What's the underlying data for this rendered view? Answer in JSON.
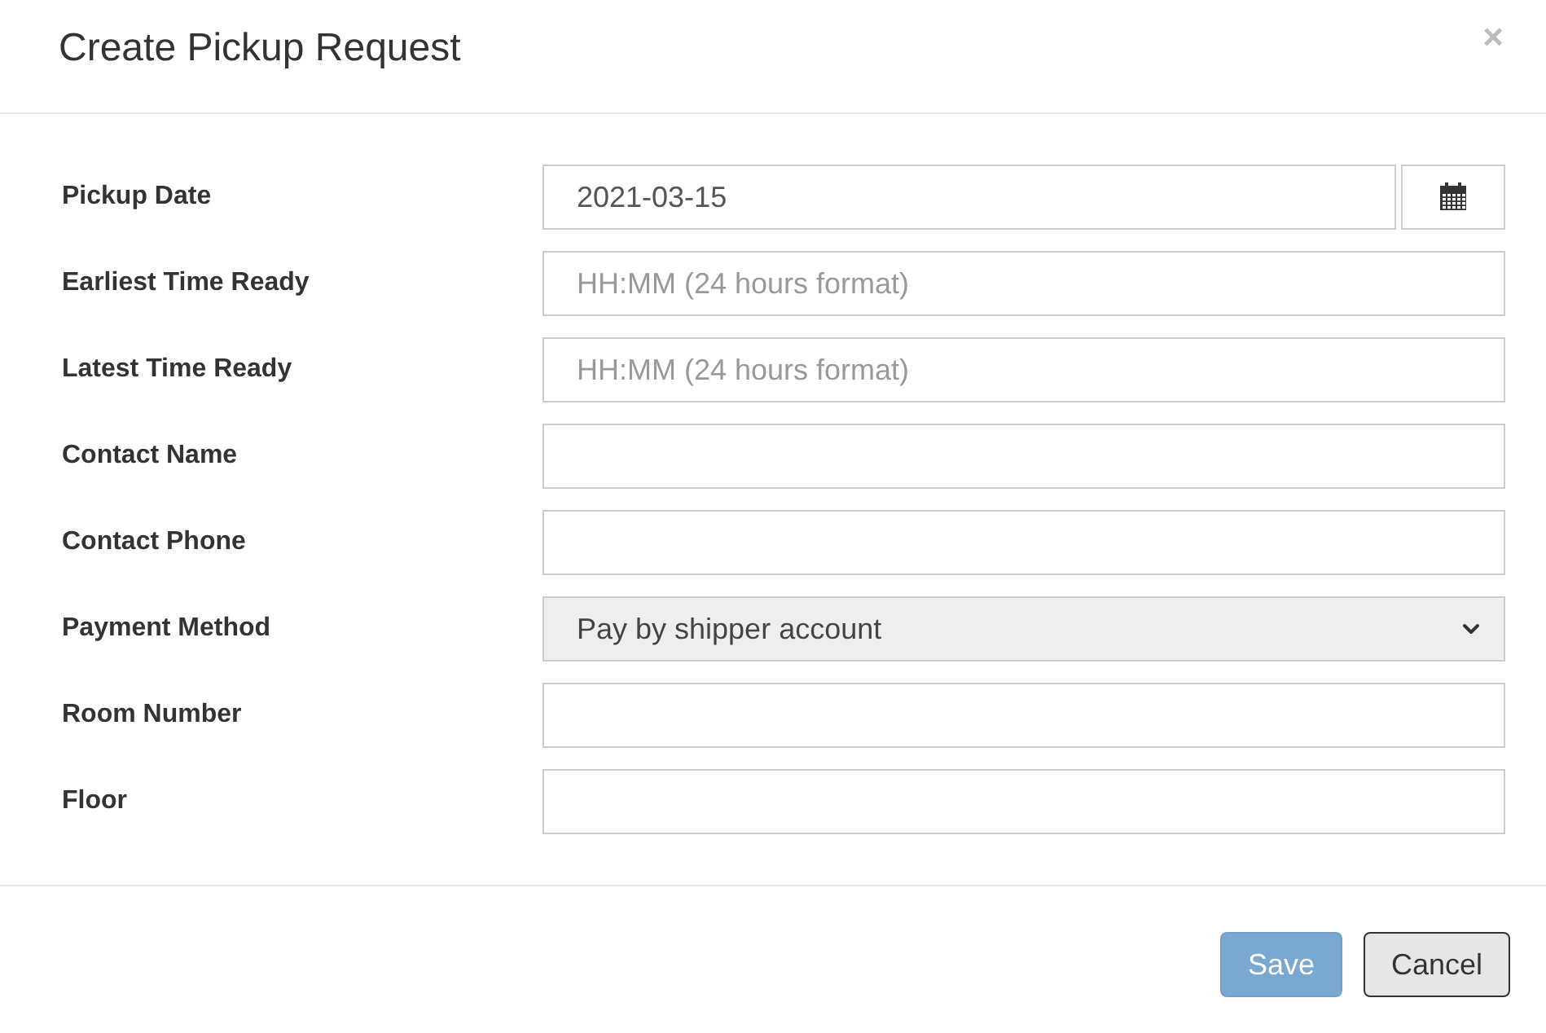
{
  "dialog": {
    "title": "Create Pickup Request",
    "close": "×"
  },
  "fields": [
    {
      "label": "Pickup Date",
      "kind": "date",
      "value": "2021-03-15"
    },
    {
      "label": "Earliest Time Ready",
      "kind": "text",
      "placeholder": "HH:MM (24 hours format)"
    },
    {
      "label": "Latest Time Ready",
      "kind": "text",
      "placeholder": "HH:MM (24 hours format)"
    },
    {
      "label": "Contact Name",
      "kind": "text"
    },
    {
      "label": "Contact Phone",
      "kind": "text"
    },
    {
      "label": "Payment Method",
      "kind": "select",
      "value": "Pay by shipper account"
    },
    {
      "label": "Room Number",
      "kind": "text"
    },
    {
      "label": "Floor",
      "kind": "text"
    }
  ],
  "buttons": [
    {
      "label": "Save",
      "kind": "primary",
      "disabled": true
    },
    {
      "label": "Cancel",
      "kind": "default",
      "disabled": false
    }
  ]
}
